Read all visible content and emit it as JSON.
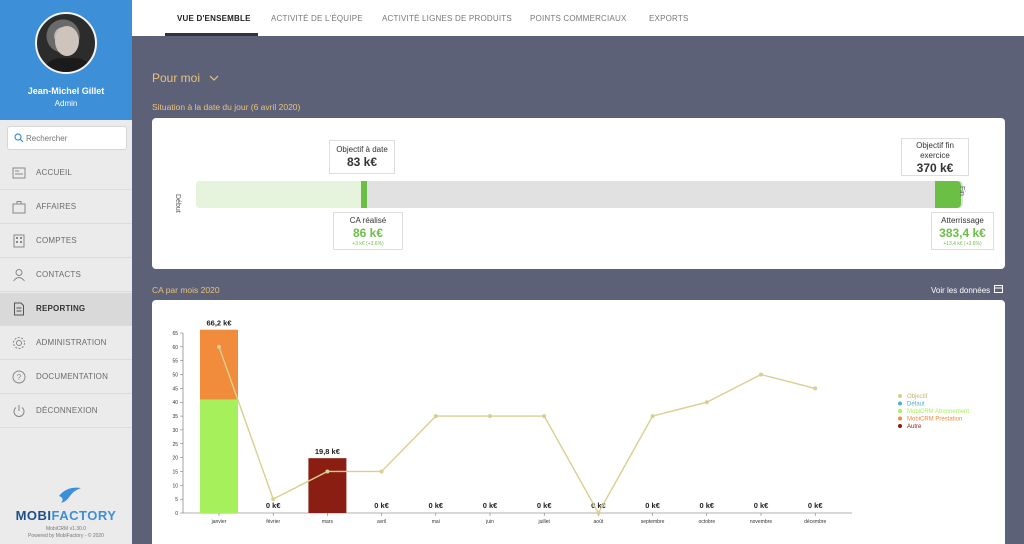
{
  "profile": {
    "name": "Jean-Michel Gillet",
    "role": "Admin"
  },
  "search": {
    "placeholder": "Rechercher"
  },
  "nav": {
    "items": [
      {
        "label": "ACCUEIL",
        "icon": "home-icon"
      },
      {
        "label": "AFFAIRES",
        "icon": "briefcase-icon"
      },
      {
        "label": "COMPTES",
        "icon": "building-icon"
      },
      {
        "label": "CONTACTS",
        "icon": "user-icon"
      },
      {
        "label": "REPORTING",
        "icon": "document-icon",
        "active": true
      },
      {
        "label": "ADMINISTRATION",
        "icon": "gear-icon"
      },
      {
        "label": "DOCUMENTATION",
        "icon": "help-icon"
      },
      {
        "label": "DÉCONNEXION",
        "icon": "power-icon"
      }
    ]
  },
  "logo": {
    "part1": "MOBI",
    "part2": "FACTORY",
    "version": "MobiCRM v1.30.0",
    "powered": "Powered by MobiFactory - © 2020"
  },
  "tabs": [
    {
      "label": "VUE D'ENSEMBLE",
      "active": true
    },
    {
      "label": "ACTIVITÉ DE L'ÉQUIPE"
    },
    {
      "label": "ACTIVITÉ LIGNES DE PRODUITS"
    },
    {
      "label": "POINTS COMMERCIAUX"
    },
    {
      "label": "EXPORTS"
    }
  ],
  "main": {
    "pour_moi": "Pour moi",
    "situation_title": "Situation à la date du jour (6 avril 2020)",
    "ca_title": "CA par mois 2020",
    "voir_donnees": "Voir les données"
  },
  "progress": {
    "debut": "Début",
    "fin": "Fin",
    "objectif_date": {
      "title": "Objectif à date",
      "value": "83 k€"
    },
    "objectif_fin": {
      "title": "Objectif fin exercice",
      "value": "370 k€"
    },
    "ca_realise": {
      "title": "CA réalisé",
      "value": "86 k€",
      "delta": "+3 k€ (+3.6%)"
    },
    "atterrissage": {
      "title": "Atterrissage",
      "value": "383,4 k€",
      "delta": "+13,4 k€ (+3.6%)"
    },
    "realise_fraction": 0.23,
    "colors": {
      "track": "#e1e1e1",
      "fill": "#e6f3dd",
      "accent": "#6cbf45"
    }
  },
  "chart_data": {
    "type": "bar",
    "categories": [
      "janvier",
      "février",
      "mars",
      "avril",
      "mai",
      "juin",
      "juillet",
      "août",
      "septembre",
      "octobre",
      "novembre",
      "décembre"
    ],
    "ylim": [
      0,
      65
    ],
    "yticks": [
      0,
      5,
      10,
      15,
      20,
      25,
      30,
      35,
      40,
      45,
      50,
      55,
      60,
      65
    ],
    "bar_labels": [
      "66,2 k€",
      "0 k€",
      "19,8 k€",
      "0 k€",
      "0 k€",
      "0 k€",
      "0 k€",
      "0 k€",
      "0 k€",
      "0 k€",
      "0 k€",
      "0 k€"
    ],
    "series": [
      {
        "name": "Défaut",
        "type": "bar",
        "color": "#4bb3c7",
        "values": [
          0,
          0,
          0,
          0,
          0,
          0,
          0,
          0,
          0,
          0,
          0,
          0
        ]
      },
      {
        "name": "MobiCRM Abonnement",
        "type": "bar",
        "color": "#a6f05c",
        "values": [
          41,
          0,
          0,
          0,
          0,
          0,
          0,
          0,
          0,
          0,
          0,
          0
        ]
      },
      {
        "name": "MobiCRM Prestation",
        "type": "bar",
        "color": "#f08c3c",
        "values": [
          25.2,
          0,
          0,
          0,
          0,
          0,
          0,
          0,
          0,
          0,
          0,
          0
        ]
      },
      {
        "name": "Autre",
        "type": "bar",
        "color": "#8b1e12",
        "values": [
          0,
          0,
          19.8,
          0,
          0,
          0,
          0,
          0,
          0,
          0,
          0,
          0
        ]
      },
      {
        "name": "Objectif",
        "type": "line",
        "color": "#d9cf8f",
        "values": [
          60,
          5,
          15,
          15,
          35,
          35,
          35,
          0,
          35,
          40,
          50,
          45
        ]
      }
    ],
    "legend_position": "right"
  }
}
